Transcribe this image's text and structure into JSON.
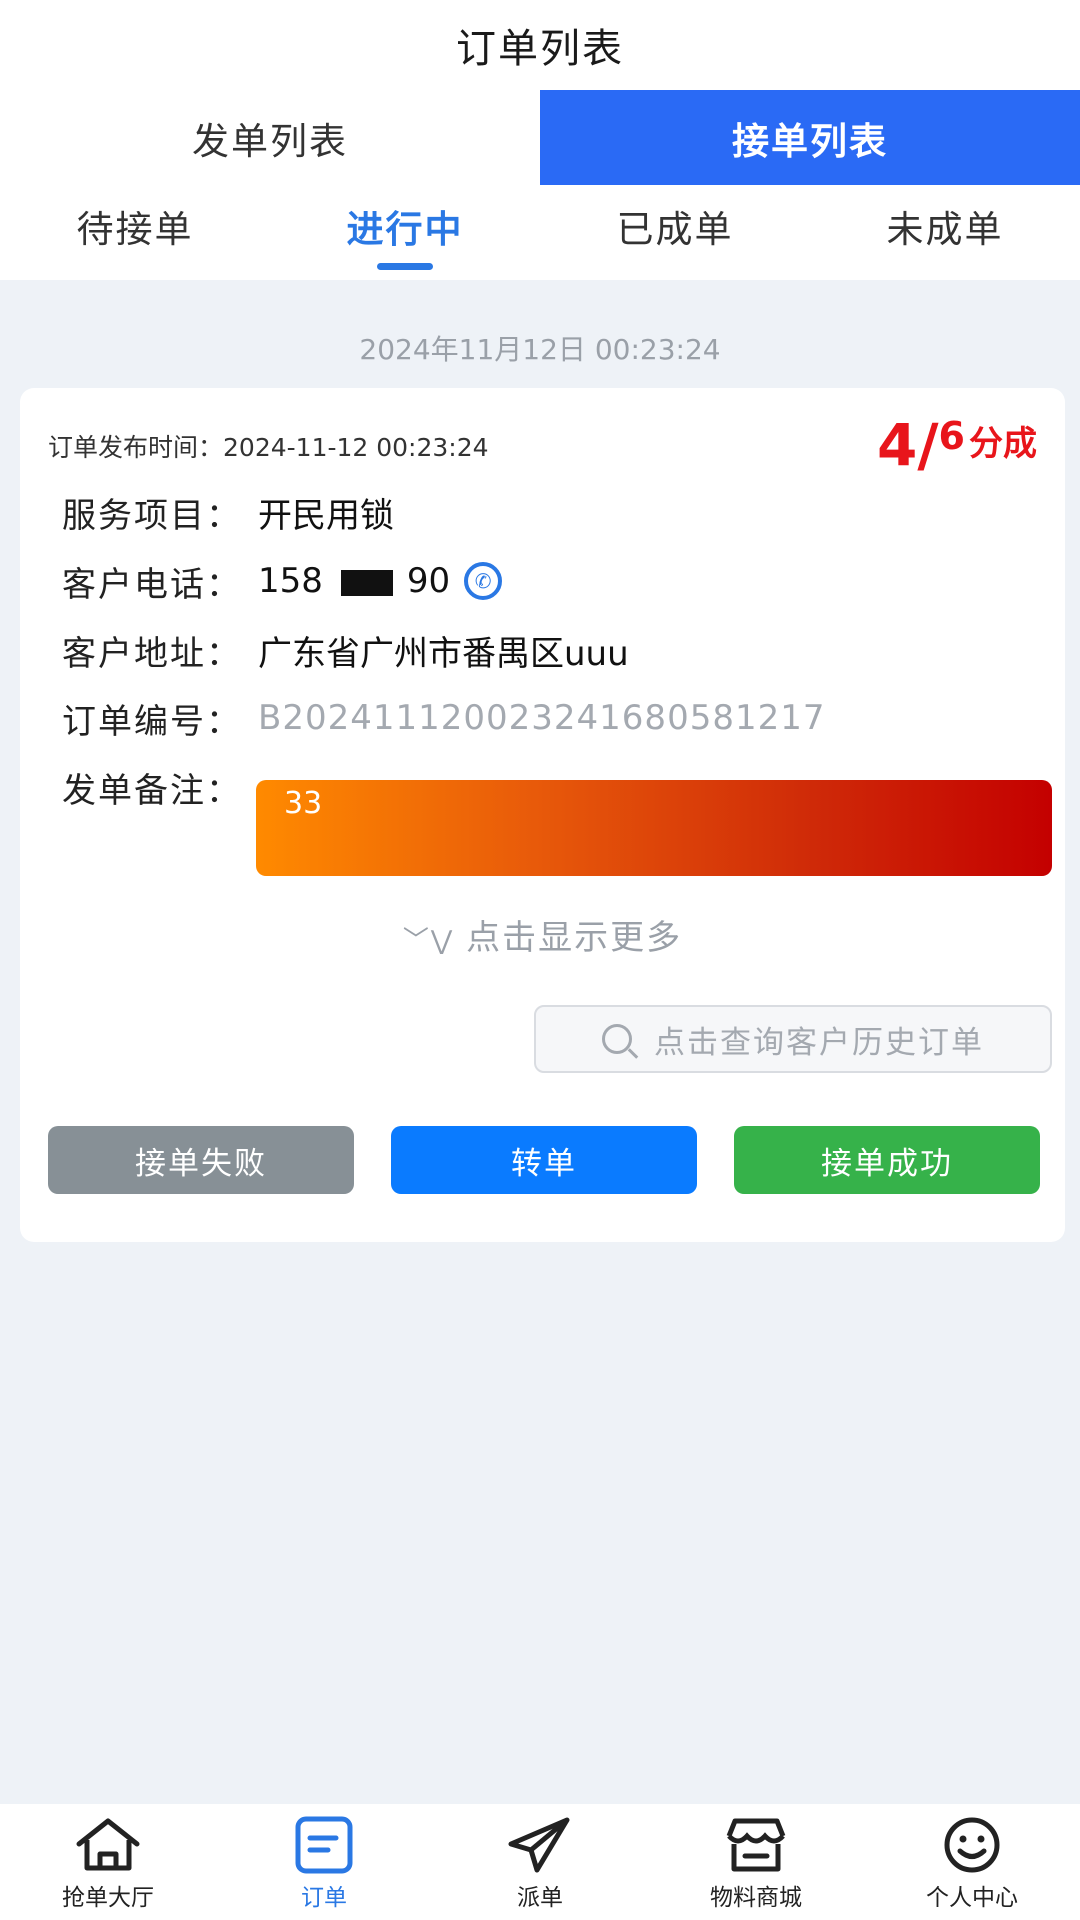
{
  "header": {
    "title": "订单列表"
  },
  "main_tabs": [
    {
      "label": "发单列表",
      "active": false
    },
    {
      "label": "接单列表",
      "active": true
    }
  ],
  "sub_tabs": [
    {
      "label": "待接单",
      "active": false
    },
    {
      "label": "进行中",
      "active": true
    },
    {
      "label": "已成单",
      "active": false
    },
    {
      "label": "未成单",
      "active": false
    }
  ],
  "date_stamp": "2024年11月12日 00:23:24",
  "order": {
    "publish_label": "订单发布时间：",
    "publish_time": "2024-11-12 00:23:24",
    "split": {
      "first": "4",
      "slash": "/",
      "second": "6",
      "unit": "分成"
    },
    "service_label": "服务项目：",
    "service_value": "开民用锁",
    "phone_label": "客户电话：",
    "phone_prefix": "158",
    "phone_suffix": "90",
    "address_label": "客户地址：",
    "address_value": "广东省广州市番禺区uuu",
    "order_no_label": "订单编号：",
    "order_no_value": "B20241112002324168058121​7",
    "remark_label": "发单备注：",
    "remark_value": "33",
    "more_toggle": "点击显示更多",
    "history_button": "点击查询客户历史订单",
    "actions": {
      "fail": "接单失败",
      "transfer": "转单",
      "success": "接单成功"
    }
  },
  "bottom_nav": [
    {
      "label": "抢单大厅",
      "icon": "home-icon",
      "active": false
    },
    {
      "label": "订单",
      "icon": "order-doc-icon",
      "active": true
    },
    {
      "label": "派单",
      "icon": "paper-plane-icon",
      "active": false
    },
    {
      "label": "物料商城",
      "icon": "store-icon",
      "active": false
    },
    {
      "label": "个人中心",
      "icon": "smiley-icon",
      "active": false
    }
  ],
  "colors": {
    "primary": "#2a6af5",
    "accent_blue": "#2a78e4",
    "split_red": "#e8151b",
    "fail_gray": "#879096",
    "transfer_blue": "#0a7bff",
    "success_green": "#36b24a",
    "background": "#eef2f7"
  }
}
